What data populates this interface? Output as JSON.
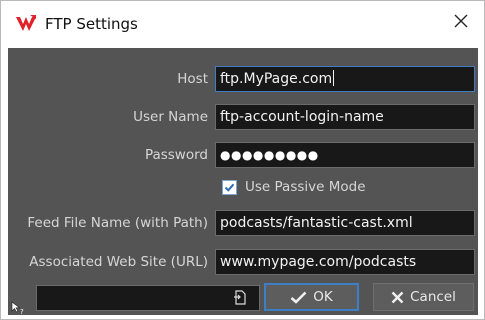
{
  "window": {
    "title": "FTP Settings",
    "app_icon": "wavelab-logo-icon",
    "close_icon": "close-icon"
  },
  "form": {
    "host": {
      "label": "Host",
      "value": "ftp.MyPage.com"
    },
    "user_name": {
      "label": "User Name",
      "value": "ftp-account-login-name"
    },
    "password": {
      "label": "Password",
      "value": "●●●●●●●●●"
    },
    "passive_mode": {
      "label": "Use Passive Mode",
      "checked": true
    },
    "feed_file": {
      "label": "Feed File Name (with Path)",
      "value": "podcasts/fantastic-cast.xml"
    },
    "web_site": {
      "label": "Associated Web Site (URL)",
      "value": "www.mypage.com/podcasts"
    }
  },
  "footer": {
    "path_value": "",
    "browse_icon": "file-browse-icon",
    "ok_label": "OK",
    "cancel_label": "Cancel",
    "help_icon": "help-cursor-icon"
  },
  "colors": {
    "body_bg": "#545454",
    "field_bg": "#181818",
    "focus_accent": "#3e7fc4",
    "app_icon_red": "#e0222a"
  }
}
